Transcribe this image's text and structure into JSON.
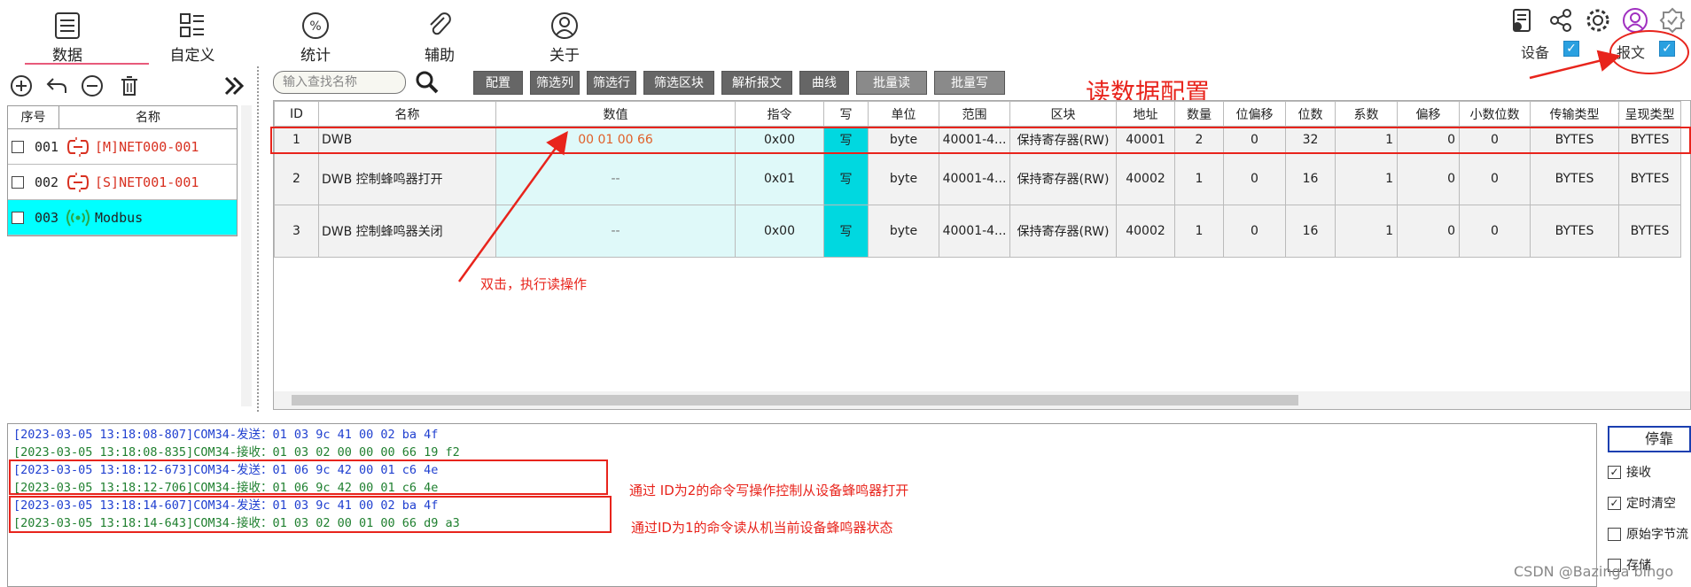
{
  "nav": {
    "tabs": [
      {
        "label": "数据",
        "icon": "list-icon"
      },
      {
        "label": "自定义",
        "icon": "layout-icon"
      },
      {
        "label": "统计",
        "icon": "percent-icon"
      },
      {
        "label": "辅助",
        "icon": "paperclip-icon"
      },
      {
        "label": "关于",
        "icon": "user-icon"
      }
    ],
    "device_label": "设备",
    "message_label": "报文"
  },
  "left": {
    "columns": [
      "序号",
      "名称"
    ],
    "rows": [
      {
        "no": "001",
        "name": "[M]NET000-001",
        "icon": "broken-link-icon"
      },
      {
        "no": "002",
        "name": "[S]NET001-001",
        "icon": "broken-link-icon"
      },
      {
        "no": "003",
        "name": "Modbus",
        "icon": "signal-icon"
      }
    ]
  },
  "toolbar": {
    "search_placeholder": "输入查找名称",
    "buttons": [
      "配置",
      "筛选列",
      "筛选行",
      "筛选区块",
      "解析报文",
      "曲线",
      "批量读",
      "批量写"
    ],
    "annotation_title": "读数据配置"
  },
  "grid": {
    "columns": [
      "ID",
      "名称",
      "数值",
      "指令",
      "写",
      "单位",
      "范围",
      "区块",
      "地址",
      "数量",
      "位偏移",
      "位数",
      "系数",
      "偏移",
      "小数位数",
      "传输类型",
      "呈现类型"
    ],
    "rows": [
      [
        "1",
        "DWB",
        "00 01 00 66",
        "0x00",
        "写",
        "byte",
        "40001-4...",
        "保持寄存器(RW)",
        "40001",
        "2",
        "0",
        "32",
        "1",
        "0",
        "0",
        "BYTES",
        "BYTES"
      ],
      [
        "2",
        "DWB 控制蜂鸣器打开",
        "--",
        "0x01",
        "写",
        "byte",
        "40001-4...",
        "保持寄存器(RW)",
        "40002",
        "1",
        "0",
        "16",
        "1",
        "0",
        "0",
        "BYTES",
        "BYTES"
      ],
      [
        "3",
        "DWB 控制蜂鸣器关闭",
        "--",
        "0x00",
        "写",
        "byte",
        "40001-4...",
        "保持寄存器(RW)",
        "40002",
        "1",
        "0",
        "16",
        "1",
        "0",
        "0",
        "BYTES",
        "BYTES"
      ]
    ],
    "annotation_dblclick": "双击，执行读操作"
  },
  "log": {
    "lines": [
      {
        "type": "send",
        "text": "[2023-03-05 13:18:08-807]COM34-发送：01 03 9c 41 00 02 ba 4f"
      },
      {
        "type": "recv",
        "text": "[2023-03-05 13:18:08-835]COM34-接收：01 03 02 00 00 00 66 19 f2"
      },
      {
        "type": "send",
        "text": "[2023-03-05 13:18:12-673]COM34-发送：01 06 9c 42 00 01 c6 4e"
      },
      {
        "type": "recv",
        "text": "[2023-03-05 13:18:12-706]COM34-接收：01 06 9c 42 00 01 c6 4e"
      },
      {
        "type": "send",
        "text": "[2023-03-05 13:18:14-607]COM34-发送：01 03 9c 41 00 02 ba 4f"
      },
      {
        "type": "recv",
        "text": "[2023-03-05 13:18:14-643]COM34-接收：01 03 02 00 01 00 66 d9 a3"
      }
    ],
    "annotation_write": "通过    ID为2的命令写操作控制从设备蜂鸣器打开",
    "annotation_read": "通过ID为1的命令读从机当前设备蜂鸣器状态"
  },
  "side": {
    "dock_button": "停靠",
    "options": [
      {
        "label": "接收",
        "checked": true
      },
      {
        "label": "定时清空",
        "checked": true
      },
      {
        "label": "原始字节流",
        "checked": false
      },
      {
        "label": "存储",
        "checked": false
      }
    ]
  },
  "watermark": "CSDN @Bazinga bingo"
}
